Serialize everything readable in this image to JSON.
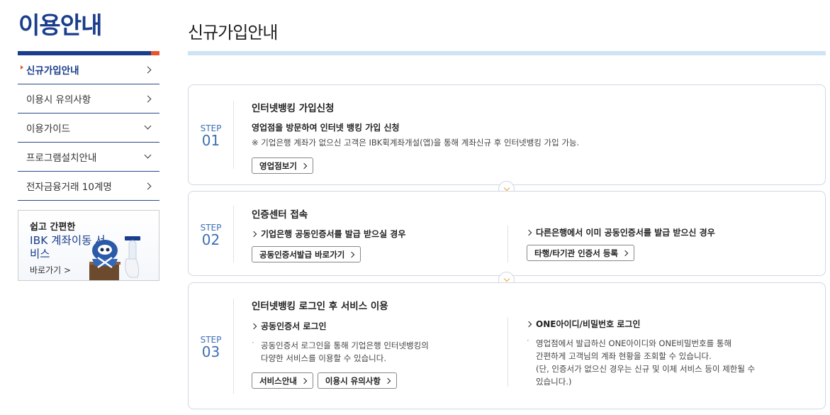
{
  "sidebar": {
    "title": "이용안내",
    "items": [
      {
        "label": "신규가입안내",
        "active": true,
        "chevron": "chevron-right-icon"
      },
      {
        "label": "이용시 유의사항",
        "active": false,
        "chevron": "chevron-right-icon"
      },
      {
        "label": "이용가이드",
        "active": false,
        "chevron": "chevron-down-icon"
      },
      {
        "label": "프로그램설치안내",
        "active": false,
        "chevron": "chevron-down-icon"
      },
      {
        "label": "전자금융거래 10계명",
        "active": false,
        "chevron": "chevron-right-icon"
      }
    ],
    "banner": {
      "line1": "쉽고 간편한",
      "line2": "IBK 계좌이동 서비스",
      "link": "바로가기 >"
    }
  },
  "main": {
    "title": "신규가입안내",
    "steps": [
      {
        "step_word": "STEP",
        "step_no": "01",
        "heading": "인터넷뱅킹 가입신청",
        "sub": "영업점을 방문하여 인터넷 뱅킹 가입 신청",
        "note": "※ 기업은행 계좌가 없으신 고객은 IBK휙계좌개설(앱)을 통해 계좌신규 후 인터넷뱅킹 가입 가능.",
        "button": "영업점보기"
      },
      {
        "step_word": "STEP",
        "step_no": "02",
        "heading": "인증센터 접속",
        "left_sub": "기업은행 공동인증서를 발급 받으실 경우",
        "left_button": "공동인증서발급 바로가기",
        "right_sub": "다른은행에서 이미 공동인증서를 발급 받으신 경우",
        "right_button": "타행/타기관 인증서 등록"
      },
      {
        "step_word": "STEP",
        "step_no": "03",
        "heading": "인터넷뱅킹 로그인 후 서비스 이용",
        "left_sub": "공동인증서 로그인",
        "left_text_1": "공동인증서 로그인을 통해 기업은행 인터넷뱅킹의",
        "left_text_2": "다양한 서비스를 이용할 수 있습니다.",
        "left_button_1": "서비스안내",
        "left_button_2": "이용시 유의사항",
        "right_sub": "ONE아이디/비밀번호 로그인",
        "right_text_1": "영업점에서 발급하신 ONE아이디와 ONE비밀번호를 통해",
        "right_text_2": "간편하게 고객님의 계좌 현황을 조회할 수 있습니다.",
        "right_text_3": "(단, 인증서가 없으신 경우는 신규 및 이체 서비스 등이 제한될 수",
        "right_text_4": "있습니다.)"
      }
    ]
  },
  "colors": {
    "brand_blue": "#1a3e8c",
    "step_blue": "#3d6fb6",
    "accent_orange": "#e8542e",
    "connector_orange": "#e8a33a",
    "title_line": "#cde4f5"
  }
}
